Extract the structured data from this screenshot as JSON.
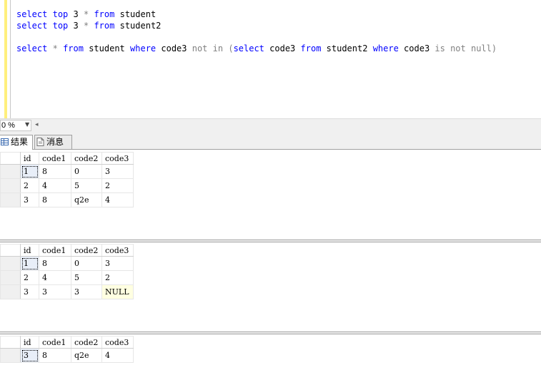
{
  "editor": {
    "line1": {
      "kw1": "select",
      "kw2": "top",
      "num": "3",
      "star": "*",
      "kw3": "from",
      "table": "student"
    },
    "line2": {
      "kw1": "select",
      "kw2": "top",
      "num": "3",
      "star": "*",
      "kw3": "from",
      "table": "student2"
    },
    "line3": {
      "kw1": "select",
      "star": "*",
      "kw2": "from",
      "table1": "student",
      "kw3": "where",
      "col1": "code3",
      "op1": "not in",
      "paren_open": "(",
      "kw4": "select",
      "col2": "code3",
      "kw5": "from",
      "table2": "student2",
      "kw6": "where",
      "col3": "code3",
      "op2": "is not null",
      "paren_close": ")"
    }
  },
  "zoom": {
    "value": "0 %"
  },
  "tabs": {
    "results": "结果",
    "messages": "消息"
  },
  "results": [
    {
      "columns": [
        "id",
        "code1",
        "code2",
        "code3"
      ],
      "rows": [
        [
          "1",
          "8",
          "0",
          "3"
        ],
        [
          "2",
          "4",
          "5",
          "2"
        ],
        [
          "3",
          "8",
          "q2e",
          "4"
        ]
      ]
    },
    {
      "columns": [
        "id",
        "code1",
        "code2",
        "code3"
      ],
      "rows": [
        [
          "1",
          "8",
          "0",
          "3"
        ],
        [
          "2",
          "4",
          "5",
          "2"
        ],
        [
          "3",
          "3",
          "3",
          "NULL"
        ]
      ]
    },
    {
      "columns": [
        "id",
        "code1",
        "code2",
        "code3"
      ],
      "rows": [
        [
          "3",
          "8",
          "q2e",
          "4"
        ]
      ]
    }
  ]
}
